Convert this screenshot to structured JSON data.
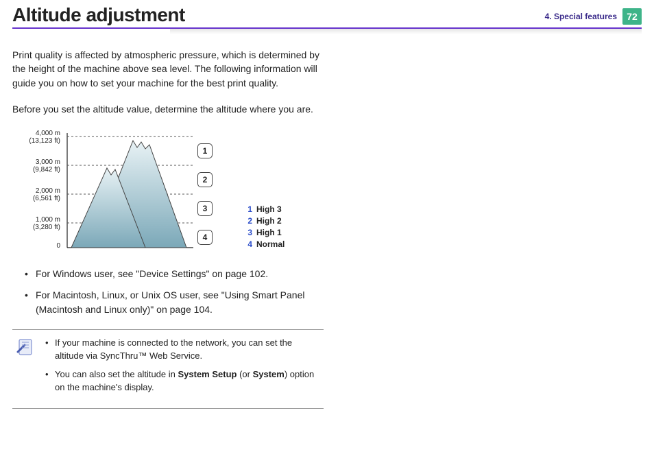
{
  "header": {
    "title": "Altitude adjustment",
    "chapter": "4.  Special features",
    "page_number": "72"
  },
  "intro": {
    "p1": "Print quality is affected by atmospheric pressure, which is determined by the height of the machine above sea level. The following information will guide you on how to set your machine for the best print quality.",
    "p2": "Before you set the altitude value, determine the altitude where you are."
  },
  "altitude_labels": {
    "l4_m": "4,000 m",
    "l4_ft": "(13,123 ft)",
    "l3_m": "3,000 m",
    "l3_ft": "(9,842 ft)",
    "l2_m": "2,000 m",
    "l2_ft": "(6,561 ft)",
    "l1_m": "1,000 m",
    "l1_ft": "(3,280 ft)",
    "l0": "0"
  },
  "markers": {
    "m1": "1",
    "m2": "2",
    "m3": "3",
    "m4": "4"
  },
  "legend": {
    "n1": "1",
    "t1": "High 3",
    "n2": "2",
    "t2": "High 2",
    "n3": "3",
    "t3": "High 1",
    "n4": "4",
    "t4": "Normal"
  },
  "bullets": {
    "b1": "For Windows user, see \"Device Settings\" on page 102.",
    "b2": "For Macintosh, Linux, or Unix OS user, see \"Using Smart Panel (Macintosh and Linux only)\" on page 104."
  },
  "note": {
    "n1": "If your machine is connected to the network, you can set the altitude via SyncThru™ Web Service.",
    "n2_pre": "You can also set the altitude in ",
    "n2_bold1": "System Setup",
    "n2_mid": " (or ",
    "n2_bold2": "System",
    "n2_post": ") option on the machine's display."
  }
}
